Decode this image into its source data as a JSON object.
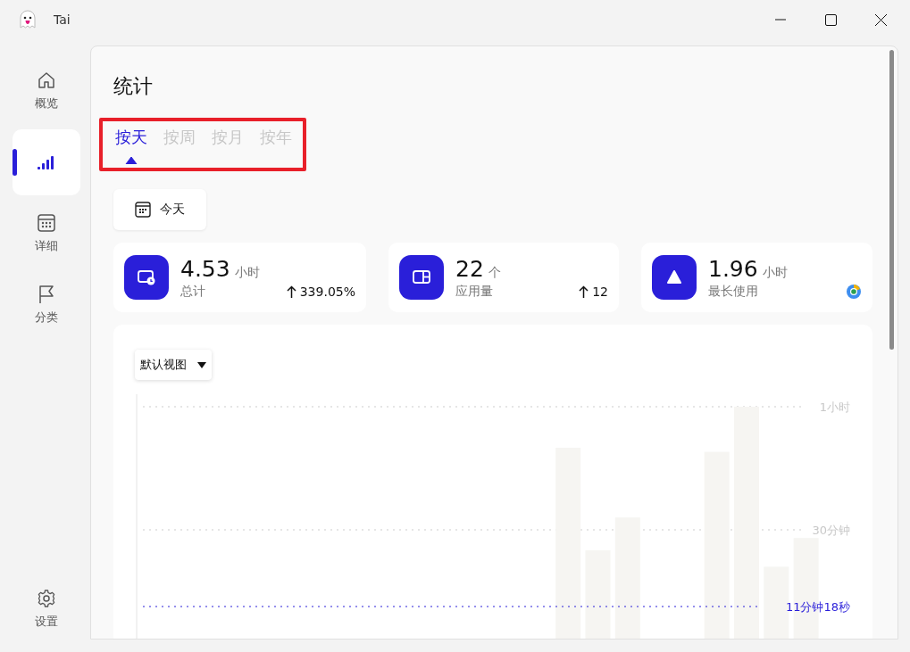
{
  "window": {
    "title": "Tai"
  },
  "sidebar": {
    "items": [
      {
        "kind": "home",
        "label": "概览",
        "selected": false
      },
      {
        "kind": "stats",
        "selected": true
      },
      {
        "kind": "calendar",
        "label": "详细",
        "selected": false
      },
      {
        "kind": "flag",
        "label": "分类",
        "selected": false
      }
    ],
    "footer": {
      "kind": "settings",
      "label": "设置"
    }
  },
  "page": {
    "title": "统计"
  },
  "tabs_highlighted": true,
  "tabs": [
    {
      "label": "按天",
      "selected": true
    },
    {
      "label": "按周",
      "selected": false
    },
    {
      "label": "按月",
      "selected": false
    },
    {
      "label": "按年",
      "selected": false
    }
  ],
  "date_button": {
    "label": "今天"
  },
  "stats": [
    {
      "kind": "total",
      "value": "4.53",
      "unit": "小时",
      "label": "总计",
      "change": "339.05%"
    },
    {
      "kind": "apps",
      "value": "22",
      "unit": "个",
      "label": "应用量",
      "change": "12"
    },
    {
      "kind": "longest",
      "value": "1.96",
      "unit": "小时",
      "label": "最长使用"
    }
  ],
  "view_dropdown": {
    "label": "默认视图"
  },
  "chart": {
    "gridline_labels": [
      "1小时",
      "30分钟"
    ],
    "average_label": "11分钟18秒"
  }
}
